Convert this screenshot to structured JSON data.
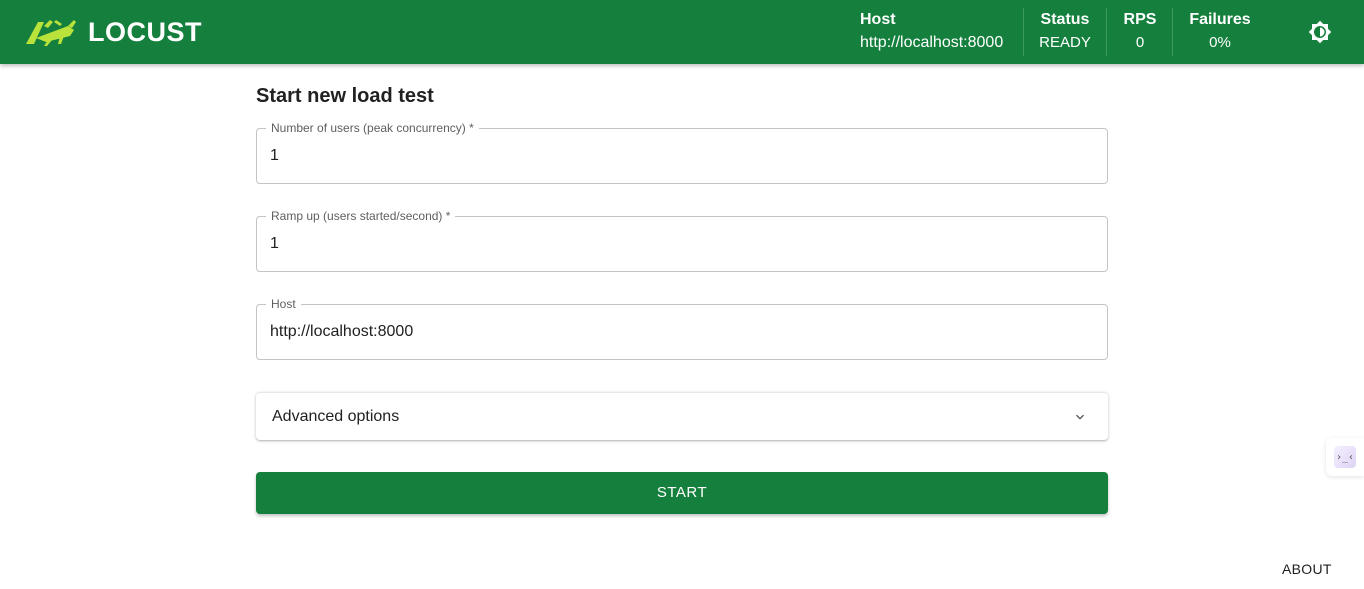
{
  "app": {
    "name": "LOCUST"
  },
  "header": {
    "host": {
      "label": "Host",
      "value": "http://localhost:8000"
    },
    "status": {
      "label": "Status",
      "value": "READY"
    },
    "rps": {
      "label": "RPS",
      "value": "0"
    },
    "failures": {
      "label": "Failures",
      "value": "0%"
    },
    "theme_icon": "brightness-icon"
  },
  "form": {
    "title": "Start new load test",
    "users": {
      "label": "Number of users (peak concurrency) *",
      "value": "1"
    },
    "ramp_up": {
      "label": "Ramp up (users started/second) *",
      "value": "1"
    },
    "host": {
      "label": "Host",
      "value": "http://localhost:8000"
    },
    "advanced": {
      "label": "Advanced options",
      "icon": "chevron-down-icon"
    },
    "start_label": "START"
  },
  "footer": {
    "about_label": "ABOUT"
  },
  "colors": {
    "brand": "#15803d",
    "text": "#212121",
    "border": "#c4c4c4"
  }
}
